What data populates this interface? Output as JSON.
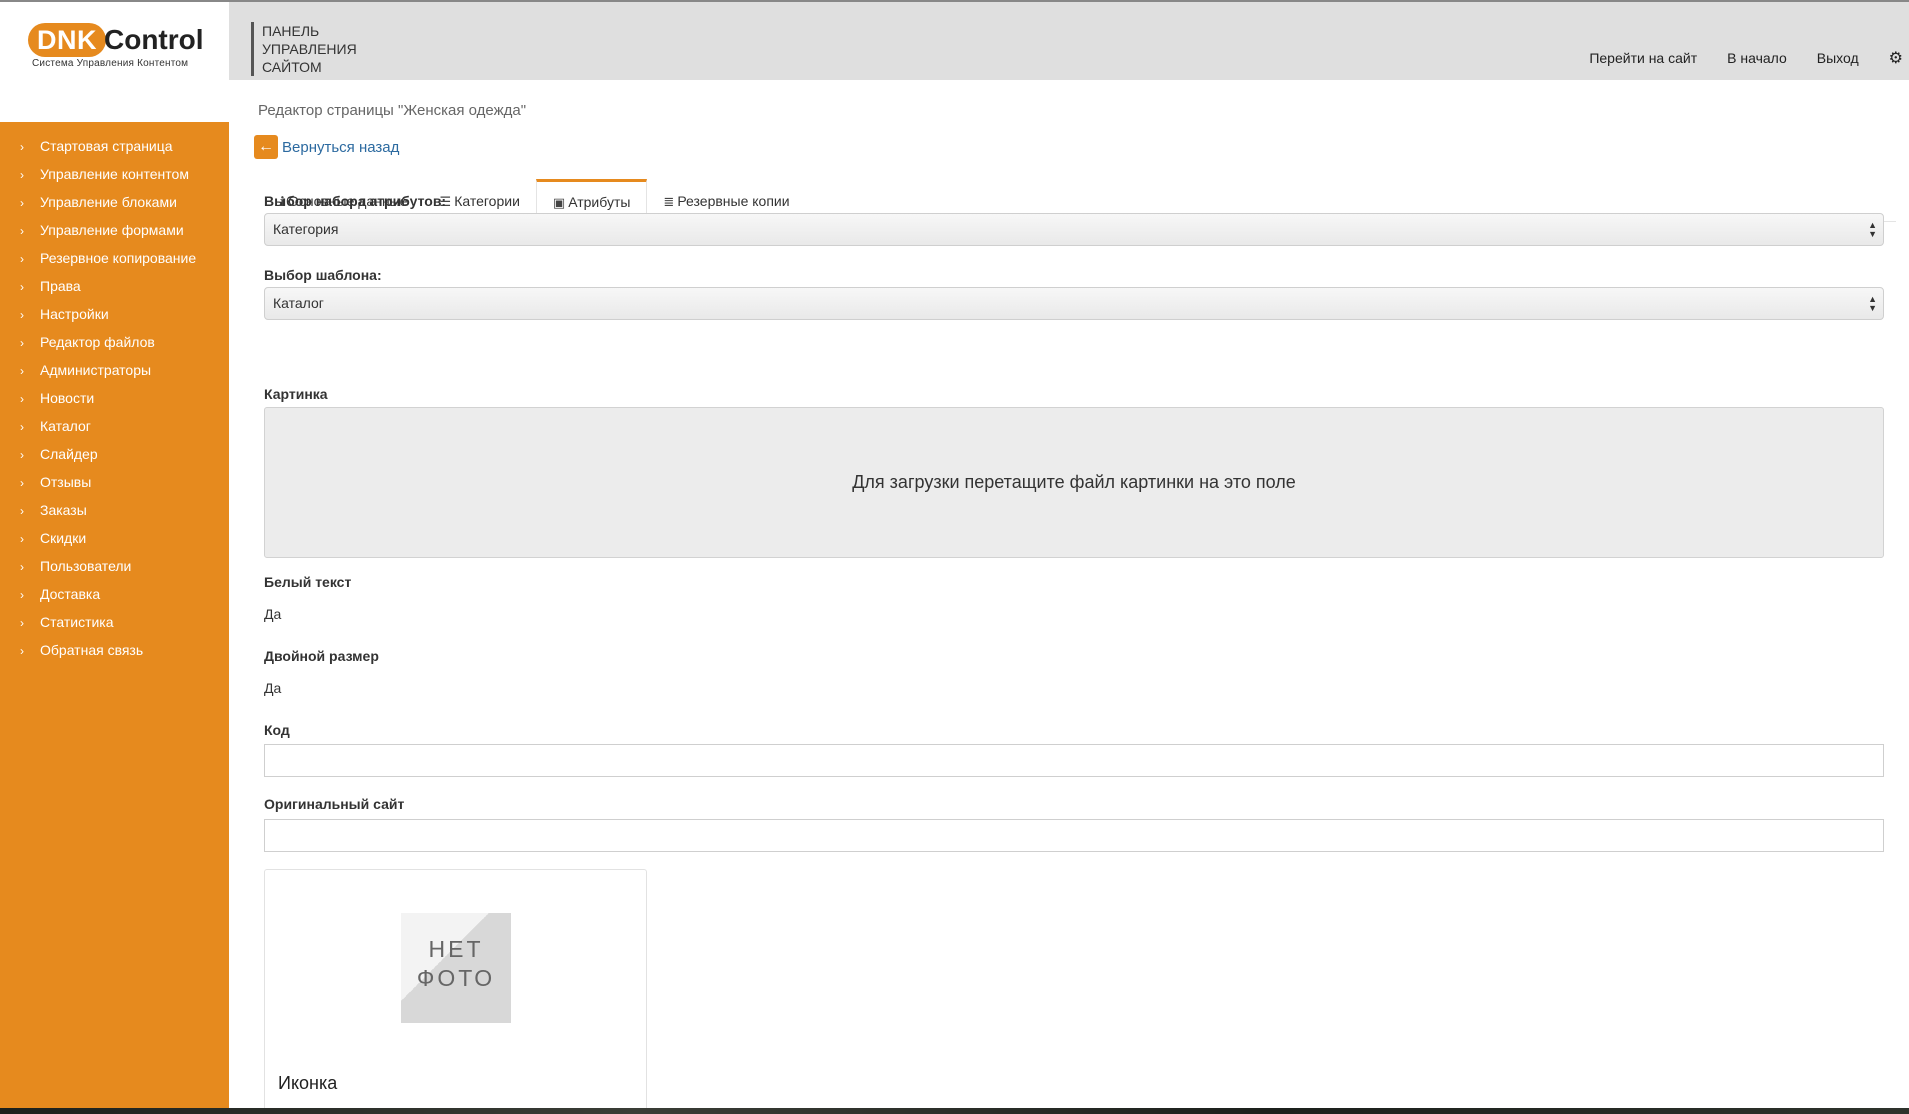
{
  "logo": {
    "part1": "DNK",
    "part2": "Control",
    "subtitle": "Система Управления Контентом"
  },
  "sidebar": {
    "items": [
      {
        "label": "Стартовая страница"
      },
      {
        "label": "Управление контентом"
      },
      {
        "label": "Управление блоками"
      },
      {
        "label": "Управление формами"
      },
      {
        "label": "Резервное копирование"
      },
      {
        "label": "Права"
      },
      {
        "label": "Настройки"
      },
      {
        "label": "Редактор файлов"
      },
      {
        "label": "Администраторы"
      },
      {
        "label": "Новости"
      },
      {
        "label": "Каталог"
      },
      {
        "label": "Слайдер"
      },
      {
        "label": "Отзывы"
      },
      {
        "label": "Заказы"
      },
      {
        "label": "Скидки"
      },
      {
        "label": "Пользователи"
      },
      {
        "label": "Доставка"
      },
      {
        "label": "Статистика"
      },
      {
        "label": "Обратная связь"
      }
    ]
  },
  "header": {
    "brand_line1": "ПАНЕЛЬ",
    "brand_line2": "УПРАВЛЕНИЯ",
    "brand_line3": "САЙТОМ",
    "nav": {
      "site": "Перейти на сайт",
      "home": "В начало",
      "logout": "Выход"
    }
  },
  "page": {
    "title": "Редактор страницы \"Женская одежда\"",
    "back": "Вернуться назад"
  },
  "tabs": [
    {
      "label": "Основные данные",
      "icon": "info-icon",
      "glyph": "ℹ"
    },
    {
      "label": "Категории",
      "icon": "list-icon",
      "glyph": "☰"
    },
    {
      "label": "Атрибуты",
      "icon": "picture-icon",
      "glyph": "▣"
    },
    {
      "label": "Резервные копии",
      "icon": "database-icon",
      "glyph": "≣"
    }
  ],
  "active_tab": "Атрибуты",
  "form": {
    "attr_set_label": "Выбор набора атрибутов:",
    "attr_set_value": "Категория",
    "template_label": "Выбор шаблона:",
    "template_value": "Каталог",
    "image_label": "Картинка",
    "dropzone_text": "Для загрузки перетащите файл картинки на это поле",
    "white_text_label": "Белый текст",
    "white_text_value": "Да",
    "double_size_label": "Двойной размер",
    "double_size_value": "Да",
    "code_label": "Код",
    "code_value": "",
    "orig_site_label": "Оригинальный сайт",
    "orig_site_value": ""
  },
  "icon_card": {
    "nophoto_line1": "НЕТ",
    "nophoto_line2": "ФОТО",
    "title": "Иконка"
  },
  "colors": {
    "accent": "#e68a1e",
    "header_bg": "#dfdfdf",
    "link": "#2c6aa0",
    "danger": "#d9403a"
  }
}
